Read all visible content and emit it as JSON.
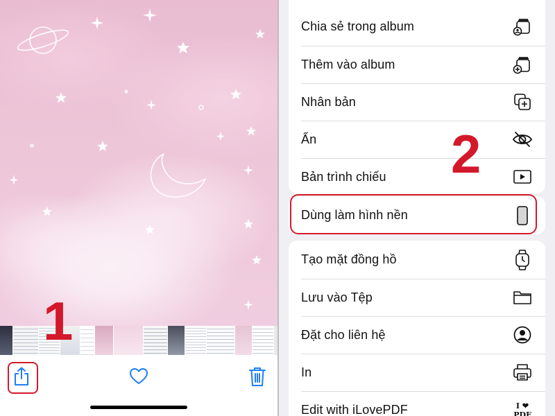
{
  "photos": {
    "toolbar": {
      "share_icon": "share-icon",
      "favorite_icon": "heart-icon",
      "delete_icon": "trash-icon"
    },
    "step_one": "1"
  },
  "share_sheet": {
    "step_two": "2",
    "actions_group_1": [
      {
        "label": "Chia sẻ trong album",
        "icon": "shared-album-icon"
      },
      {
        "label": "Thêm vào album",
        "icon": "add-to-album-icon"
      },
      {
        "label": "Nhân bản",
        "icon": "duplicate-icon"
      },
      {
        "label": "Ẩn",
        "icon": "hide-eye-icon"
      },
      {
        "label": "Bản trình chiếu",
        "icon": "slideshow-play-icon"
      }
    ],
    "highlighted_action": {
      "label": "Dùng làm hình nền",
      "icon": "phone-wallpaper-icon"
    },
    "actions_group_3": [
      {
        "label": "Tạo mặt đồng hồ",
        "icon": "watch-icon"
      },
      {
        "label": "Lưu vào Tệp",
        "icon": "folder-icon"
      },
      {
        "label": "Đặt cho liên hệ",
        "icon": "contact-icon"
      },
      {
        "label": "In",
        "icon": "printer-icon"
      },
      {
        "label": "Edit with iLovePDF",
        "icon": "ilovepdf-icon",
        "icon_text": "I ❤ PDF"
      }
    ]
  },
  "colors": {
    "highlight": "#d3182b",
    "accent": "#1e7ef2",
    "sheet_background": "#efeff4"
  }
}
